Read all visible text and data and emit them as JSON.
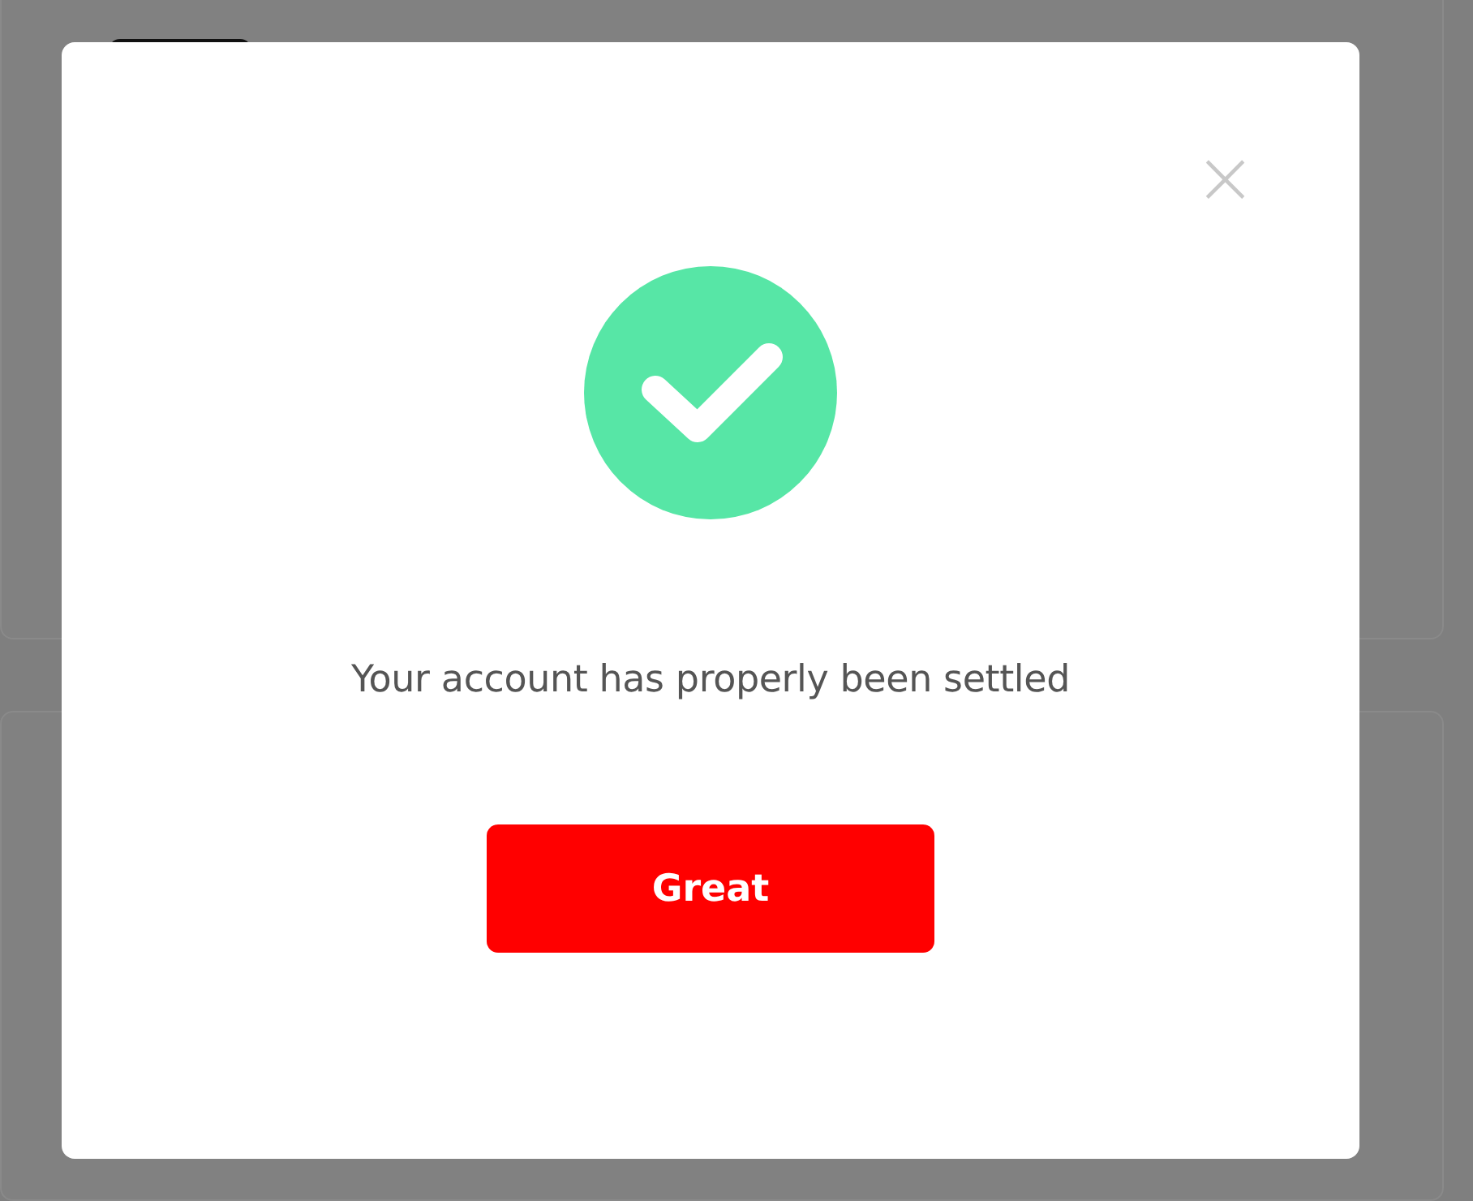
{
  "dialog": {
    "message": "Your account has properly been settled",
    "confirm_button": "Great",
    "close_label": "×"
  }
}
